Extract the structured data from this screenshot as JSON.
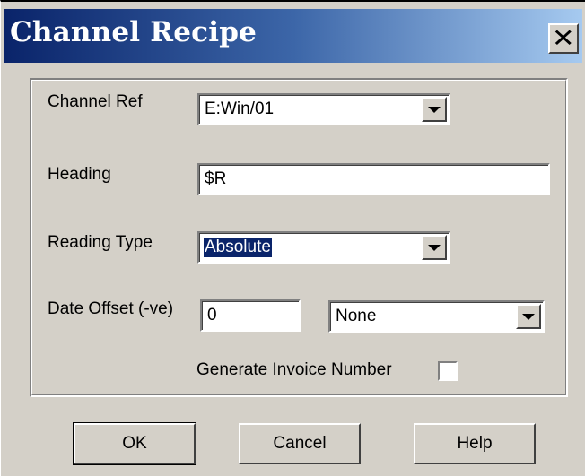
{
  "window": {
    "title": "Channel Recipe",
    "close_glyph": "✕"
  },
  "form": {
    "channel_ref": {
      "label": "Channel Ref",
      "value": "E:Win/01"
    },
    "heading": {
      "label": "Heading",
      "value": "$R"
    },
    "reading_type": {
      "label": "Reading Type",
      "value": "Absolute"
    },
    "date_offset": {
      "label": "Date Offset (-ve)",
      "value": "0",
      "unit_value": "None"
    },
    "invoice": {
      "label": "Generate Invoice Number",
      "checked": false
    }
  },
  "buttons": {
    "ok": "OK",
    "cancel": "Cancel",
    "help": "Help"
  },
  "icons": {
    "close": "close-icon",
    "dropdown": "chevron-down-icon"
  },
  "colors": {
    "face": "#d4d0c8",
    "title_start": "#0a246a",
    "title_end": "#a6caf0",
    "selection": "#0a246a"
  }
}
